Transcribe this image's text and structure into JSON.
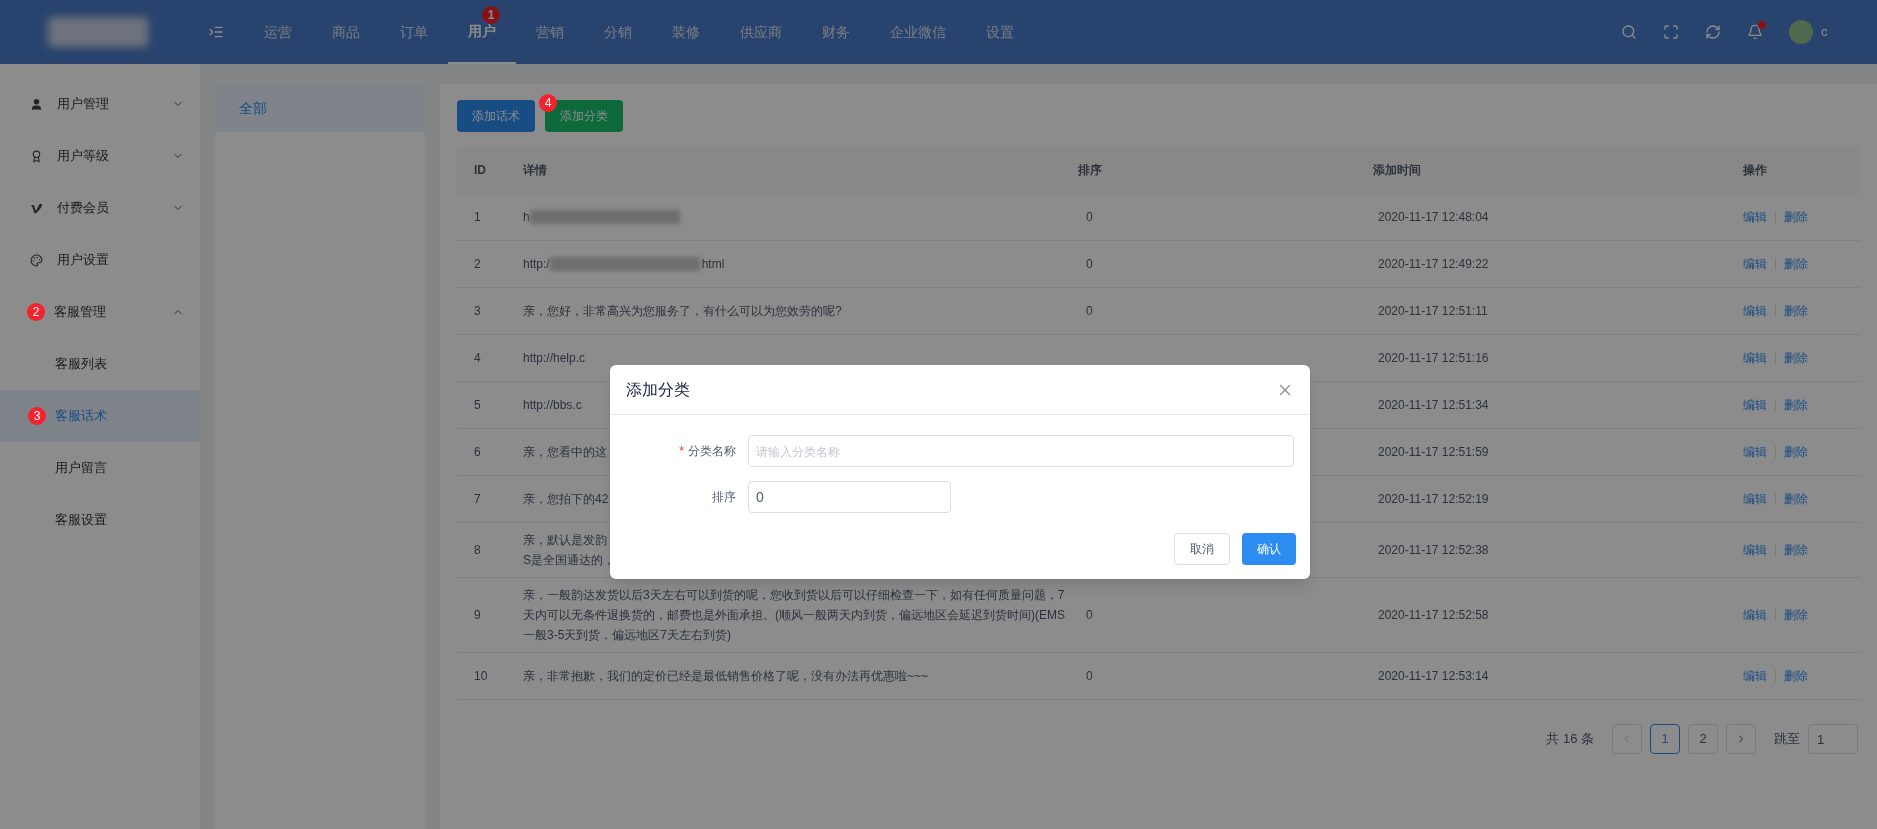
{
  "topbar": {
    "nav": [
      {
        "label": "运营",
        "selected": false
      },
      {
        "label": "商品",
        "selected": false
      },
      {
        "label": "订单",
        "selected": false
      },
      {
        "label": "用户",
        "selected": true,
        "marker": "1"
      },
      {
        "label": "营销",
        "selected": false
      },
      {
        "label": "分销",
        "selected": false
      },
      {
        "label": "装修",
        "selected": false
      },
      {
        "label": "供应商",
        "selected": false
      },
      {
        "label": "财务",
        "selected": false
      },
      {
        "label": "企业微信",
        "selected": false
      },
      {
        "label": "设置",
        "selected": false
      }
    ],
    "notification_dot": true,
    "username": "c"
  },
  "sidebar": {
    "items": [
      {
        "label": "用户管理",
        "expanded": false,
        "selected": false
      },
      {
        "label": "用户等级",
        "expanded": false,
        "selected": false
      },
      {
        "label": "付费会员",
        "expanded": false,
        "selected": false
      },
      {
        "label": "用户设置",
        "selected": false
      },
      {
        "label": "客服管理",
        "marker": "2",
        "expanded": true,
        "selected": false,
        "children": [
          {
            "label": "客服列表",
            "selected": false
          },
          {
            "label": "客服话术",
            "selected": true,
            "marker": "3"
          },
          {
            "label": "用户留言",
            "selected": false
          },
          {
            "label": "客服设置",
            "selected": false
          }
        ]
      }
    ]
  },
  "categories": [
    {
      "label": "全部",
      "selected": true
    }
  ],
  "toolbar": {
    "buttons": [
      {
        "label": "添加话术",
        "kind": "primary"
      },
      {
        "label": "添加分类",
        "kind": "success",
        "marker": "4"
      }
    ]
  },
  "table": {
    "columns": [
      "ID",
      "详情",
      "排序",
      "添加时间",
      "操作"
    ],
    "rows": [
      {
        "id": "1",
        "detail": "h",
        "blurred": true,
        "sort": "0",
        "time": "2020-11-17 12:48:04",
        "actions": [
          "编辑",
          "删除"
        ]
      },
      {
        "id": "2",
        "detail": "http:/",
        "detail_end": "html",
        "blurred": true,
        "sort": "0",
        "time": "2020-11-17 12:49:22",
        "actions": [
          "编辑",
          "删除"
        ]
      },
      {
        "id": "3",
        "detail": "亲，您好，非常高兴为您服务了，有什么可以为您效劳的呢?",
        "sort": "0",
        "time": "2020-11-17 12:51:11",
        "actions": [
          "编辑",
          "删除"
        ]
      },
      {
        "id": "4",
        "detail": "http://help.c",
        "time": "2020-11-17 12:51:16",
        "actions": [
          "编辑",
          "删除"
        ]
      },
      {
        "id": "5",
        "detail": "http://bbs.c",
        "time": "2020-11-17 12:51:34",
        "actions": [
          "编辑",
          "删除"
        ]
      },
      {
        "id": "6",
        "detail": "亲，您看中的这",
        "time": "2020-11-17 12:51:59",
        "actions": [
          "编辑",
          "删除"
        ]
      },
      {
        "id": "7",
        "detail": "亲，您拍下的42",
        "time": "2020-11-17 12:52:19",
        "actions": [
          "编辑",
          "删除"
        ]
      },
      {
        "id": "8",
        "detail": "亲，默认是发韵\nS是全国通达的，",
        "time": "2020-11-17 12:52:38",
        "actions": [
          "编辑",
          "删除"
        ]
      },
      {
        "id": "9",
        "detail": "亲，一般韵达发货以后3天左右可以到货的呢，您收到货以后可以仔细检查一下，如有任何质量问题，7天内可以无条件退换货的，邮费也是外面承担。(顺风一般两天内到货，偏远地区会延迟到货时间)(EMS一般3-5天到货，偏远地区7天左右到货)",
        "sort": "0",
        "time": "2020-11-17 12:52:58",
        "actions": [
          "编辑",
          "删除"
        ]
      },
      {
        "id": "10",
        "detail": "亲，非常抱歉，我们的定价已经是最低销售价格了呢，没有办法再优惠啦~~~",
        "sort": "0",
        "time": "2020-11-17 12:53:14",
        "actions": [
          "编辑",
          "删除"
        ]
      }
    ]
  },
  "pagination": {
    "total": "共 16 条",
    "pages": [
      {
        "label": "1",
        "selected": true
      },
      {
        "label": "2",
        "selected": false
      }
    ],
    "jump_label": "跳至",
    "jump_value": "1"
  },
  "dialog": {
    "title": "添加分类",
    "fields": [
      {
        "label": "分类名称",
        "required_mark": "*",
        "placeholder": "请输入分类名称"
      },
      {
        "label": "排序",
        "value": "0"
      }
    ],
    "buttons": [
      {
        "label": "取消",
        "kind": "default"
      },
      {
        "label": "确认",
        "kind": "primary"
      }
    ]
  }
}
